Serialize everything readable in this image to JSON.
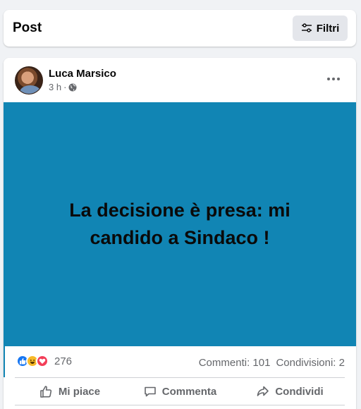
{
  "header": {
    "title": "Post",
    "filter_label": "Filtri"
  },
  "post": {
    "author": "Luca Marsico",
    "time": "3 h",
    "separator": "·",
    "text": "La decisione è presa: mi candido a Sindaco !",
    "background_color": "#1185b4",
    "reactions": {
      "icons": [
        "like-icon",
        "haha-icon",
        "love-icon"
      ],
      "count": "276"
    },
    "comments": "Commenti: 101",
    "shares": "Condivisioni: 2"
  },
  "actions": {
    "like": "Mi piace",
    "comment": "Commenta",
    "share": "Condividi"
  }
}
